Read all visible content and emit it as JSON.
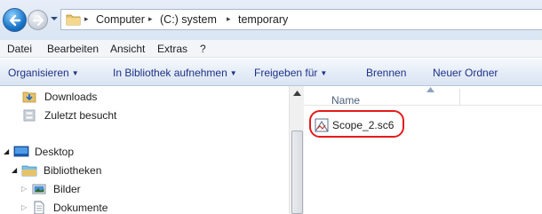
{
  "address_bar": {
    "crumbs": [
      "Computer",
      "(C:) system",
      "temporary"
    ],
    "separator": "▸"
  },
  "menu": {
    "items": [
      "Datei",
      "Bearbeiten",
      "Ansicht",
      "Extras",
      "?"
    ]
  },
  "toolbar": {
    "organize": "Organisieren",
    "include_library": "In Bibliothek aufnehmen",
    "share": "Freigeben für",
    "burn": "Brennen",
    "new_folder": "Neuer Ordner",
    "dropdown_arrow": "▼"
  },
  "nav_pane": {
    "downloads": "Downloads",
    "recent": "Zuletzt besucht",
    "desktop": "Desktop",
    "libraries": "Bibliotheken",
    "pictures": "Bilder",
    "documents": "Dokumente"
  },
  "content": {
    "column_name": "Name",
    "files": [
      {
        "name": "Scope_2.sc6",
        "icon": "scope-file-icon"
      }
    ]
  },
  "colors": {
    "highlight": "#e41b1b",
    "accent": "#1e3287"
  }
}
